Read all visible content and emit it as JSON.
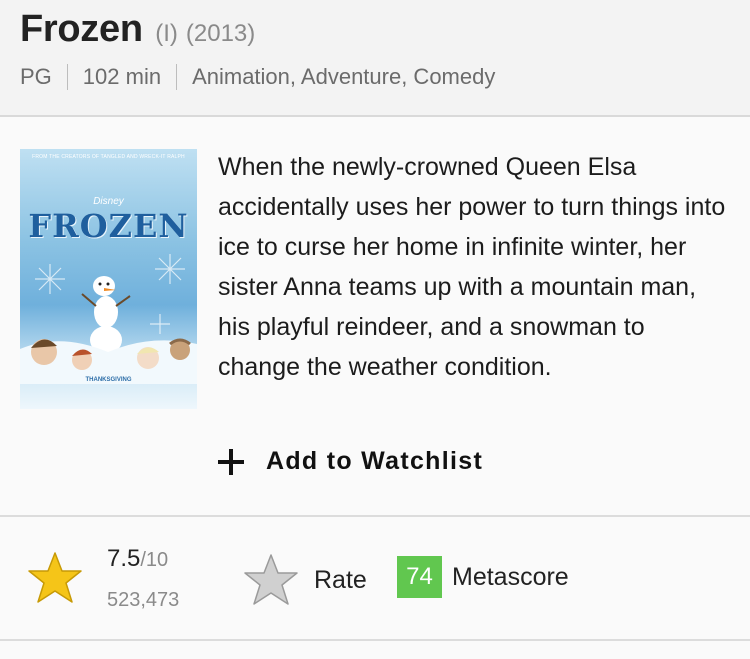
{
  "movie": {
    "title": "Frozen",
    "title_qualifier": "(I)",
    "year": "(2013)",
    "rating_cert": "PG",
    "runtime": "102 min",
    "genres": "Animation, Adventure, Comedy",
    "plot": "When the newly-crowned Queen Elsa accidentally uses her power to turn things into ice to curse her home in infinite winter, her sister Anna teams up with a mountain man, his playful reindeer, and a snowman to change the weather condition."
  },
  "poster": {
    "top_credit": "FROM THE CREATORS OF TANGLED AND WRECK-IT RALPH",
    "studio": "Disney",
    "title": "FROZEN",
    "release": "THANKSGIVING"
  },
  "actions": {
    "watchlist_label": "Add to Watchlist",
    "watchlist_icon": "plus-icon"
  },
  "ratings": {
    "score": "7.5",
    "score_outof": "/10",
    "vote_count": "523,473",
    "rate_label": "Rate",
    "metascore": "74",
    "metascore_label": "Metascore",
    "star_color": "#f5c518",
    "metascore_color": "#61c74f"
  }
}
